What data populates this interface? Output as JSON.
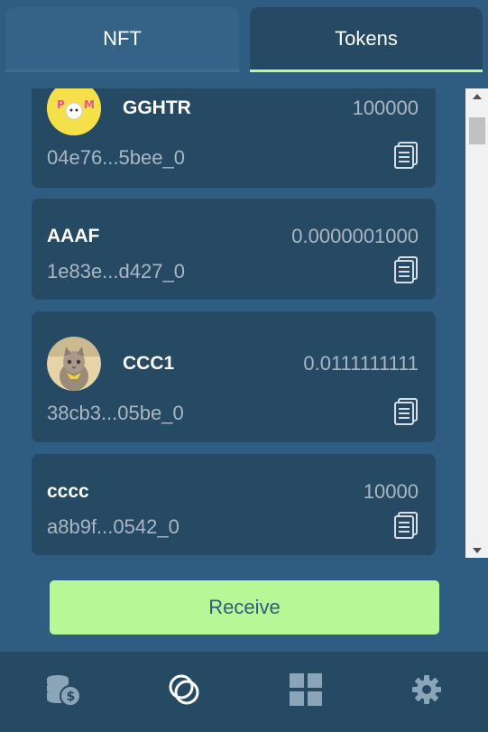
{
  "tabs": [
    {
      "label": "NFT",
      "active": false
    },
    {
      "label": "Tokens",
      "active": true
    }
  ],
  "tokens": [
    {
      "name": "GGHTR",
      "amount": "100000",
      "address": "04e76...5bee_0",
      "icon": "ppm-logo-icon"
    },
    {
      "name": "AAAF",
      "amount": "0.0000001000",
      "address": "1e83e...d427_0",
      "icon": null
    },
    {
      "name": "CCC1",
      "amount": "0.0111111111",
      "address": "38cb3...05be_0",
      "icon": "cat-avatar-icon"
    },
    {
      "name": "cccc",
      "amount": "10000",
      "address": "a8b9f...0542_0",
      "icon": null
    }
  ],
  "receive_label": "Receive",
  "bottom_nav": [
    {
      "name": "wallet-coins-icon",
      "active": false
    },
    {
      "name": "tokens-icon",
      "active": true
    },
    {
      "name": "apps-grid-icon",
      "active": false
    },
    {
      "name": "settings-gear-icon",
      "active": false
    }
  ],
  "colors": {
    "background": "#2f5d82",
    "card": "#264a63",
    "accent": "#b7f796",
    "muted_text": "#aab7c3"
  }
}
